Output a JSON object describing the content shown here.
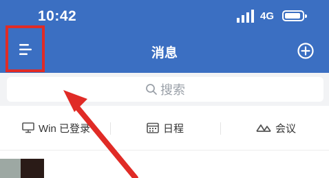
{
  "status_bar": {
    "time": "10:42",
    "network": "4G"
  },
  "header": {
    "title": "消息"
  },
  "search": {
    "placeholder": "搜索"
  },
  "tabs": [
    {
      "label": "Win 已登录"
    },
    {
      "label": "日程"
    },
    {
      "label": "会议"
    }
  ],
  "colors": {
    "header_bg": "#3b6fc2",
    "highlight": "#e02b26",
    "search_bg": "#f2f3f5"
  },
  "icons": [
    "signal-icon",
    "battery-icon",
    "menu-icon",
    "add-icon",
    "search-icon",
    "monitor-icon",
    "calendar-icon",
    "meeting-icon"
  ]
}
